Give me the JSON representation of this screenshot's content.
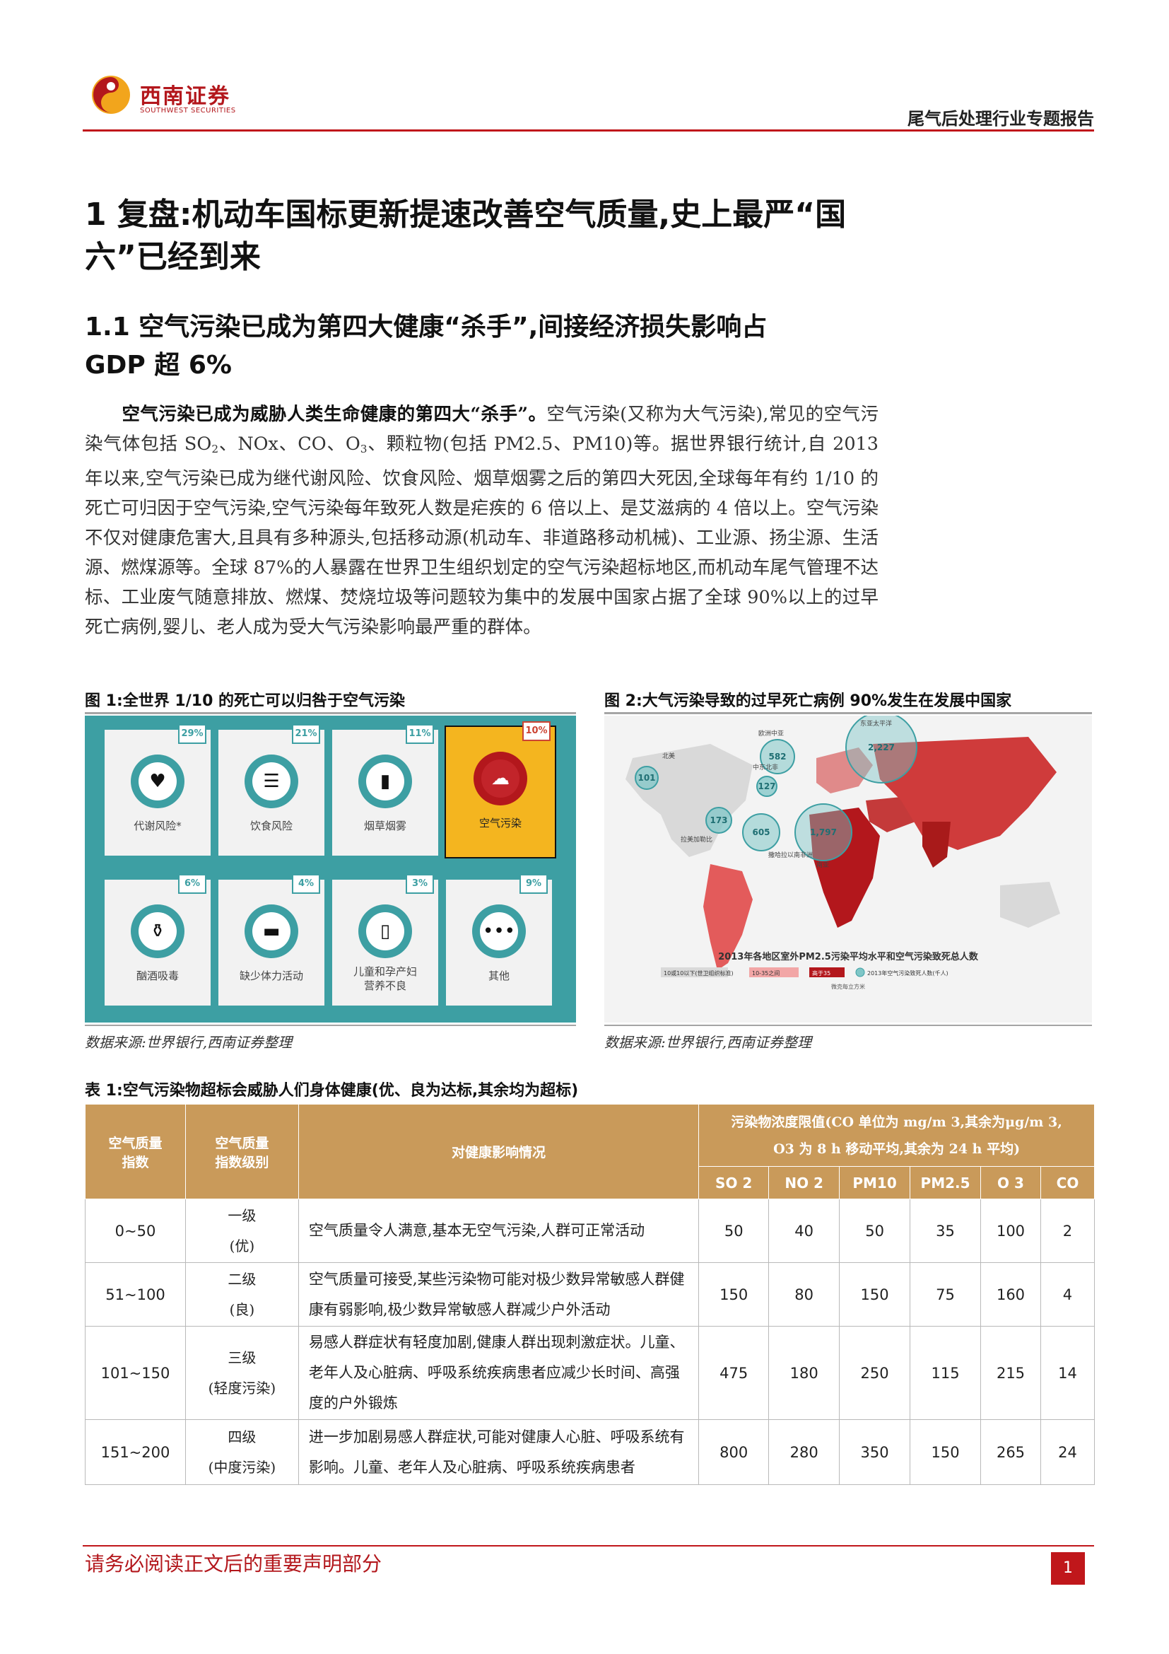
{
  "header": {
    "logo_cn": "西南证券",
    "logo_en": "SOUTHWEST SECURITIES",
    "report_title": "尾气后处理行业专题报告"
  },
  "headings": {
    "h1_line1": "1 复盘:机动车国标更新提速改善空气质量,史上最严“国",
    "h1_line2": "六”已经到来",
    "h2_line1": "1.1 空气污染已成为第四大健康“杀手”,间接经济损失影响占",
    "h2_line2": "GDP 超 6%"
  },
  "paragraph": {
    "lead": "空气污染已成为威胁人类生命健康的第四大“杀手”。",
    "s1": "空气污染(又称为大气污染),常见的空气污染气体包括 SO",
    "sub2a": "2",
    "s2": "、NOx、CO、O",
    "sub3": "3",
    "s3": "、颗粒物(包括 PM2.5、PM10)等。据世界银行统计,自 2013 年以来,空气污染已成为继代谢风险、饮食风险、烟草烟雾之后的第四大死因,全球每年有约 1/10 的死亡可归因于空气污染,空气污染每年致死人数是疟疾的 6 倍以上、是艾滋病的 4 倍以上。空气污染不仅对健康危害大,且具有多种源头,包括移动源(机动车、非道路移动机械)、工业源、扬尘源、生活源、燃煤源等。全球 87%的人暴露在世界卫生组织划定的空气污染超标地区,而机动车尾气管理不达标、工业废气随意排放、燃煤、焚烧垃圾等问题较为集中的发展中国家占据了全球 90%以上的过早死亡病例,婴儿、老人成为受大气污染影响最严重的群体。"
  },
  "figure1": {
    "caption": "图 1:全世界 1/10 的死亡可以归咎于空气污染",
    "source": "数据来源:世界银行,西南证券整理",
    "tiles": [
      {
        "pct": "29%",
        "label": "代谢风险*",
        "icon": "heart-icon"
      },
      {
        "pct": "21%",
        "label": "饮食风险",
        "icon": "burger-icon"
      },
      {
        "pct": "11%",
        "label": "烟草烟雾",
        "icon": "lighter-icon"
      },
      {
        "pct": "10%",
        "label": "空气污染",
        "icon": "factory-smoke-icon"
      },
      {
        "pct": "6%",
        "label": "酗酒吸毒",
        "icon": "bottle-icon"
      },
      {
        "pct": "4%",
        "label": "缺少体力活动",
        "icon": "sofa-icon"
      },
      {
        "pct": "3%",
        "label": "儿童和孕产妇",
        "label2": "营养不良",
        "icon": "baby-bottle-icon"
      },
      {
        "pct": "9%",
        "label": "其他",
        "icon": "dots-icon"
      }
    ]
  },
  "figure2": {
    "caption": "图 2:大气污染导致的过早死亡病例 90%发生在发展中国家",
    "source": "数据来源:世界银行,西南证券整理",
    "map_title": "2013年各地区室外PM2.5污染平均水平和空气污染致死总人数",
    "legend": [
      "10或10以下(世卫组织标准)",
      "10-35之间",
      "高于35",
      "2013年空气污染致死人数(千人)"
    ],
    "legend_colors": [
      "#d9d9d9",
      "#f2a6a6",
      "#b3171c",
      "#3d9fa3"
    ],
    "axis_note": "微克每立方米",
    "bubbles": [
      {
        "region": "北美",
        "value": "101"
      },
      {
        "region": "欧洲中亚",
        "value": "582"
      },
      {
        "region": "中东北非",
        "value": "127"
      },
      {
        "region": "东亚太平洋",
        "value": "2,227"
      },
      {
        "region": "拉美加勒比",
        "value": "173"
      },
      {
        "region": "撒哈拉以南非洲",
        "value": "605"
      },
      {
        "region": "南亚",
        "value": "1,797"
      }
    ]
  },
  "table": {
    "caption": "表 1:空气污染物超标会威胁人们身体健康(优、良为达标,其余均为超标)",
    "headers": {
      "aqi": "空气质量",
      "aqi2": "指数",
      "level": "空气质量",
      "level2": "指数级别",
      "health": "对健康影响情况",
      "limits1": "污染物浓度限值(CO 单位为 mg/m 3,其余为μg/m 3,",
      "limits2": "O3 为 8 h 移动平均,其余为 24 h 平均)",
      "pollutants": [
        "SO 2",
        "NO 2",
        "PM10",
        "PM2.5",
        "O 3",
        "CO"
      ]
    },
    "rows": [
      {
        "aqi": "0~50",
        "level": "一级",
        "level2": "(优)",
        "desc": "空气质量令人满意,基本无空气污染,人群可正常活动",
        "values": [
          "50",
          "40",
          "50",
          "35",
          "100",
          "2"
        ]
      },
      {
        "aqi": "51~100",
        "level": "二级",
        "level2": "(良)",
        "desc": "空气质量可接受,某些污染物可能对极少数异常敏感人群健康有弱影响,极少数异常敏感人群减少户外活动",
        "values": [
          "150",
          "80",
          "150",
          "75",
          "160",
          "4"
        ]
      },
      {
        "aqi": "101~150",
        "level": "三级",
        "level2": "(轻度污染)",
        "desc": "易感人群症状有轻度加剧,健康人群出现刺激症状。儿童、老年人及心脏病、呼吸系统疾病患者应减少长时间、高强度的户外锻炼",
        "values": [
          "475",
          "180",
          "250",
          "115",
          "215",
          "14"
        ]
      },
      {
        "aqi": "151~200",
        "level": "四级",
        "level2": "(中度污染)",
        "desc": "进一步加剧易感人群症状,可能对健康人心脏、呼吸系统有影响。儿童、老年人及心脏病、呼吸系统疾病患者",
        "values": [
          "800",
          "280",
          "350",
          "150",
          "265",
          "24"
        ]
      }
    ]
  },
  "footer": {
    "notice": "请务必阅读正文后的重要声明部分",
    "page": "1"
  }
}
